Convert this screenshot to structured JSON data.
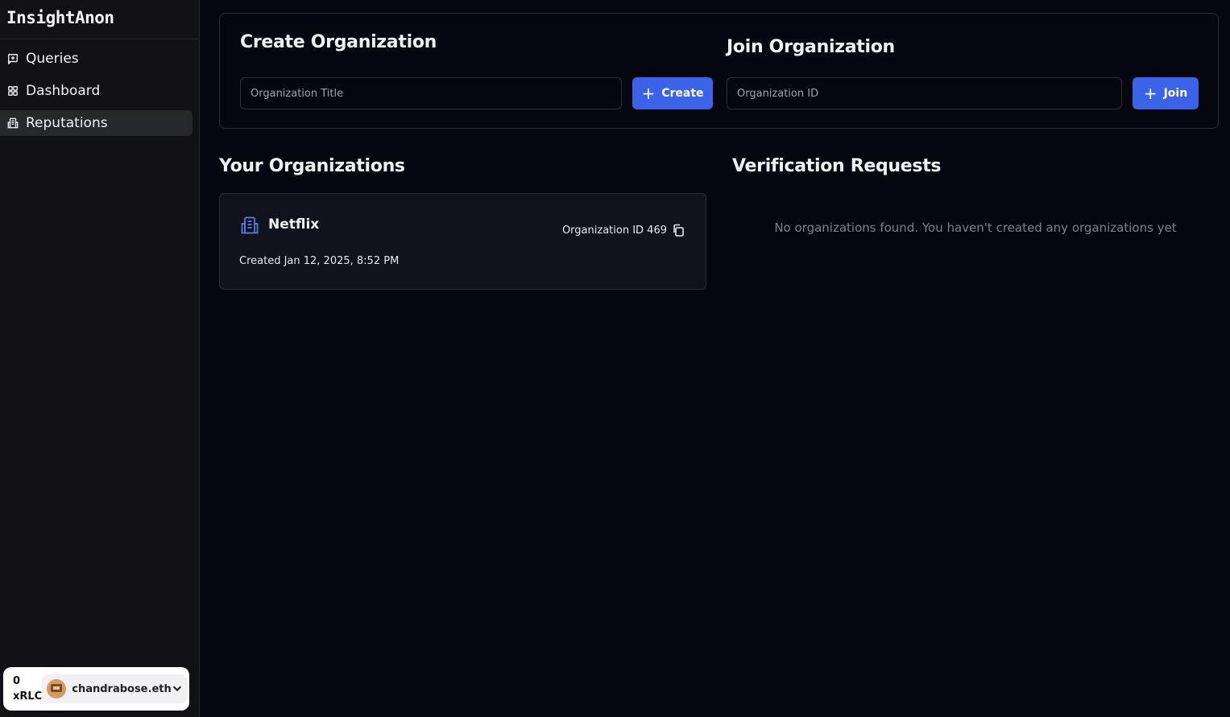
{
  "app": {
    "logo": "InsightAnon"
  },
  "sidebar": {
    "items": [
      {
        "label": "Queries",
        "icon": "message-square-icon"
      },
      {
        "label": "Dashboard",
        "icon": "grid-icon"
      },
      {
        "label": "Reputations",
        "icon": "building-icon",
        "active": true
      }
    ]
  },
  "wallet": {
    "balance_amount": "0",
    "balance_unit": "xRLC",
    "account_name": "chandrabose.eth"
  },
  "create_org": {
    "title": "Create Organization",
    "placeholder": "Organization Title",
    "button_label": "Create"
  },
  "join_org": {
    "title": "Join Organization",
    "placeholder": "Organization ID",
    "button_label": "Join"
  },
  "your_orgs": {
    "title": "Your Organizations",
    "items": [
      {
        "name": "Netflix",
        "id_text": "Organization ID 469",
        "created": "Created Jan 12, 2025, 8:52 PM"
      }
    ]
  },
  "verification": {
    "title": "Verification Requests",
    "empty_message": "No organizations found. You haven't created any organizations yet"
  },
  "colors": {
    "accent": "#3b63e8",
    "background": "#05060f",
    "sidebar": "#121216",
    "card": "#11131c"
  }
}
